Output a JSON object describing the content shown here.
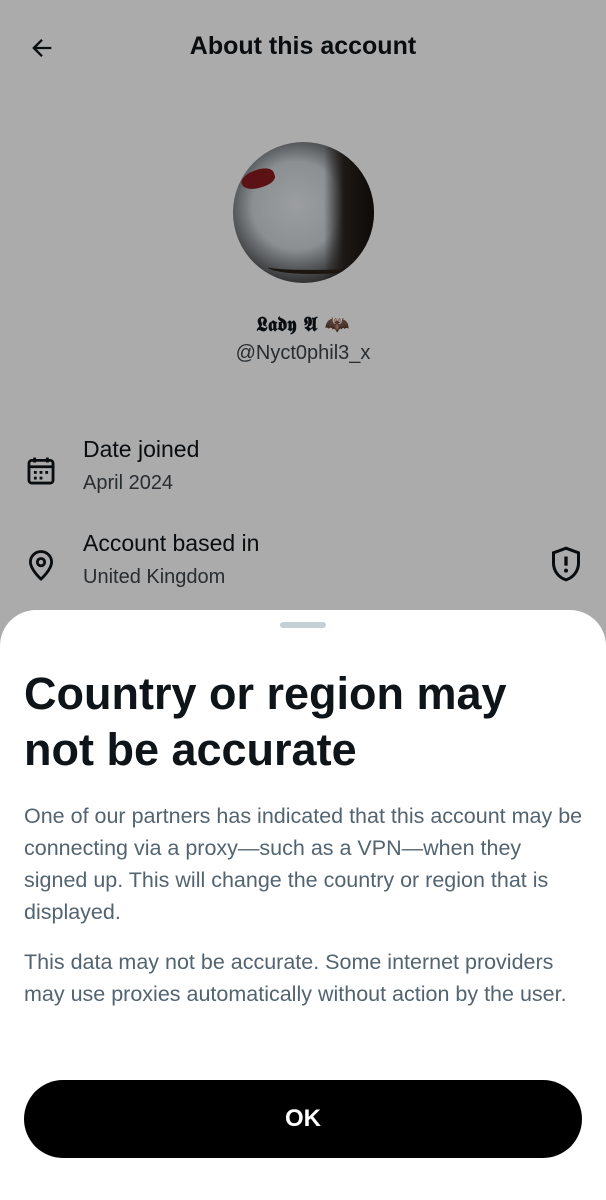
{
  "header": {
    "title": "About this account",
    "back_icon": "arrow-left-icon"
  },
  "profile": {
    "display_name": "𝕷𝖆𝖉𝖞 𝕬 🦇",
    "handle": "@Nyct0phil3_x"
  },
  "details": [
    {
      "label": "Date joined",
      "value": "April 2024",
      "icon": "calendar-icon"
    },
    {
      "label": "Account based in",
      "value": "United Kingdom",
      "icon": "location-pin-icon",
      "action_icon": "shield-alert-icon"
    }
  ],
  "sheet": {
    "title": "Country or region may not be accurate",
    "paragraphs": [
      "One of our partners has indicated that this account may be connecting via a proxy—such as a VPN—when they signed up. This will change the country or region that is displayed.",
      "This data may not be accurate. Some internet providers may use proxies automatically without action by the user."
    ],
    "ok_label": "OK"
  },
  "colors": {
    "text_primary": "#0f1419",
    "text_secondary": "#536471",
    "button_bg": "#000000",
    "scrim": "rgba(0,0,0,0.33)"
  }
}
